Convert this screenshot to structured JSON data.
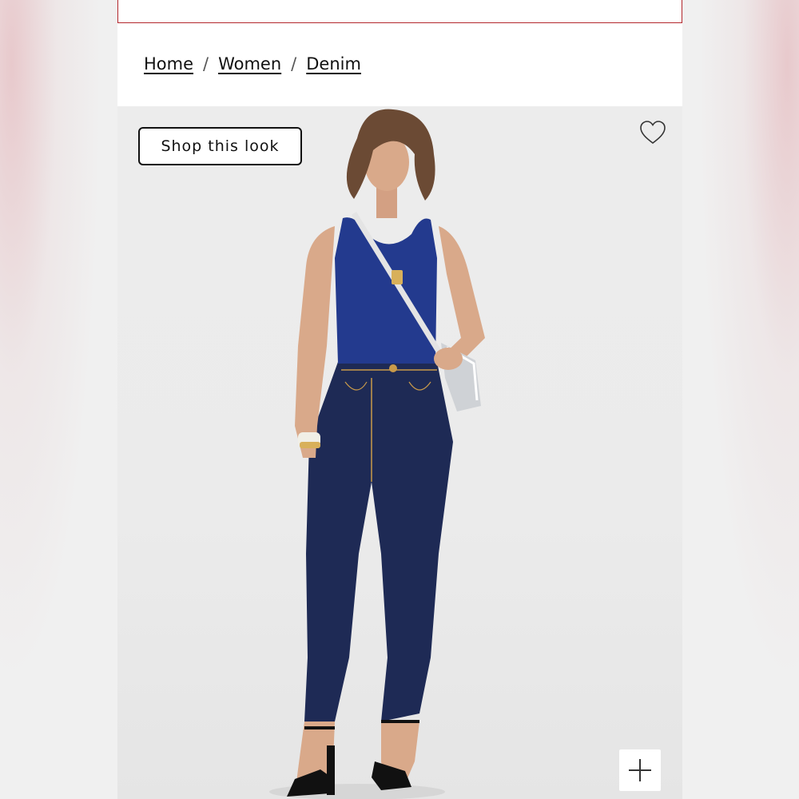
{
  "breadcrumb": {
    "items": [
      {
        "label": "Home"
      },
      {
        "label": "Women"
      },
      {
        "label": "Denim"
      }
    ],
    "separator": "/"
  },
  "hero": {
    "shop_look_label": "Shop this look",
    "wishlist_icon": "heart-icon",
    "zoom_icon": "plus-icon"
  },
  "colors": {
    "banner_border": "#b3272d",
    "top": "#233a8e",
    "denim": "#1e2a55"
  }
}
